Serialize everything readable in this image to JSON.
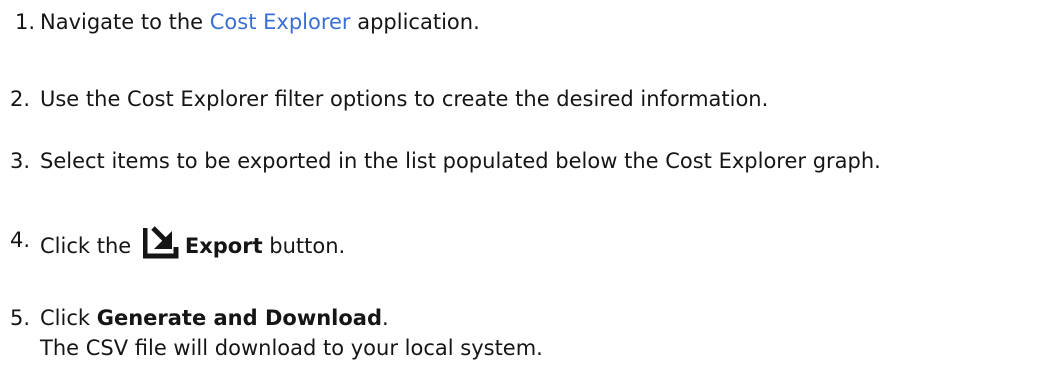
{
  "steps": [
    {
      "number": "1.",
      "prefix": "Navigate to the ",
      "link": "Cost Explorer",
      "suffix": " application."
    },
    {
      "number": "2.",
      "text": "Use the Cost Explorer filter options to create the desired information."
    },
    {
      "number": "3.",
      "text": "Select items to be exported in the list populated below the Cost Explorer graph."
    },
    {
      "number": "4.",
      "prefix": "Click the ",
      "icon": "export-icon",
      "bold": "Export",
      "suffix": " button."
    },
    {
      "number": "5.",
      "prefix": "Click ",
      "bold": "Generate and Download",
      "suffix": ".",
      "note": "The CSV file will download to your local system."
    }
  ],
  "colors": {
    "text": "#151515",
    "link": "#3b6fd6"
  }
}
